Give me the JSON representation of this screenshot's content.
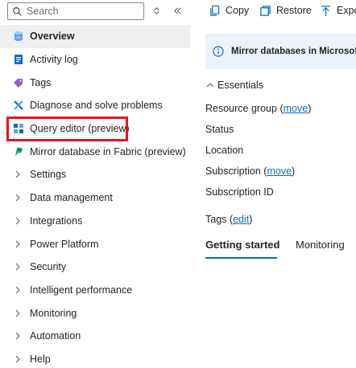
{
  "search": {
    "placeholder": "Search"
  },
  "nav": {
    "items": [
      {
        "label": "Overview",
        "icon": "sql-database-icon"
      },
      {
        "label": "Activity log",
        "icon": "activity-log-icon"
      },
      {
        "label": "Tags",
        "icon": "tag-icon"
      },
      {
        "label": "Diagnose and solve problems",
        "icon": "wrench-icon"
      },
      {
        "label": "Query editor (preview)",
        "icon": "query-editor-icon"
      },
      {
        "label": "Mirror database in Fabric (preview)",
        "icon": "fabric-icon"
      }
    ],
    "groups": [
      "Settings",
      "Data management",
      "Integrations",
      "Power Platform",
      "Security",
      "Intelligent performance",
      "Monitoring",
      "Automation",
      "Help"
    ]
  },
  "toolbar": {
    "copy": "Copy",
    "restore": "Restore",
    "export": "Expo"
  },
  "info": {
    "text": "Mirror databases in Microsoft F"
  },
  "essentials": {
    "title": "Essentials",
    "resource_group": "Resource group",
    "status": "Status",
    "location": "Location",
    "subscription": "Subscription",
    "subscription_id": "Subscription ID",
    "tags": "Tags",
    "move": "move",
    "edit": "edit",
    "open_paren": "(",
    "close_paren": ")"
  },
  "tabs": {
    "getting_started": "Getting started",
    "monitoring": "Monitoring"
  },
  "colors": {
    "accent": "#0f6cbd",
    "highlight": "#e81123",
    "info_bg": "#eaf3fb",
    "selected_bg": "#efefef"
  }
}
